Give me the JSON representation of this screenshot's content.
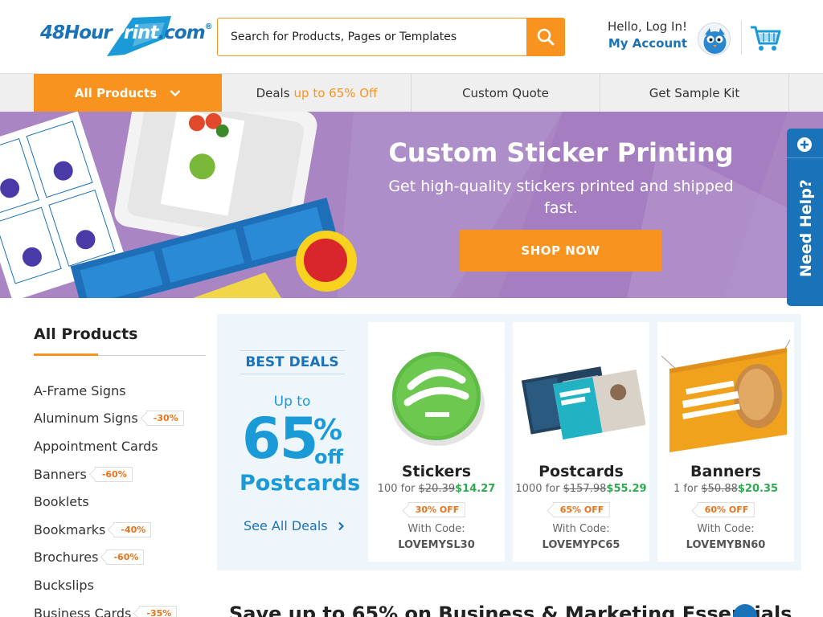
{
  "header": {
    "logo_text": "48HourPrint.com",
    "search_placeholder": "Search for Products, Pages or Templates",
    "greeting": "Hello, Log In!",
    "account_label": "My Account"
  },
  "nav": {
    "all_products": "All Products",
    "deals_label": "Deals",
    "deals_highlight": "up to 65% Off",
    "custom_quote": "Custom Quote",
    "sample_kit": "Get Sample Kit"
  },
  "hero": {
    "title": "Custom Sticker Printing",
    "subtitle": "Get high-quality stickers printed and shipped fast.",
    "button": "SHOP NOW",
    "background": "#a985c4"
  },
  "help_tab": {
    "label": "Need Help?"
  },
  "sidebar": {
    "title": "All Products",
    "items": [
      {
        "label": "A-Frame Signs",
        "badge": ""
      },
      {
        "label": "Aluminum Signs",
        "badge": "-30%"
      },
      {
        "label": "Appointment Cards",
        "badge": ""
      },
      {
        "label": "Banners",
        "badge": "-60%"
      },
      {
        "label": "Booklets",
        "badge": ""
      },
      {
        "label": "Bookmarks",
        "badge": "-40%"
      },
      {
        "label": "Brochures",
        "badge": "-60%"
      },
      {
        "label": "Buckslips",
        "badge": ""
      },
      {
        "label": "Business Cards",
        "badge": "-35%"
      }
    ]
  },
  "best_deals": {
    "title": "BEST DEALS",
    "up_to": "Up to",
    "percent": "65",
    "percent_sign": "%",
    "off": "off",
    "product": "Postcards",
    "see_all": "See All Deals"
  },
  "deal_cards": [
    {
      "name": "Stickers",
      "qty": "100 for",
      "old_price": "$20.39",
      "new_price": "$14.27",
      "badge": "30% OFF",
      "code_label": "With Code:",
      "code": "LOVEMYSL30",
      "image_icon": "sticker-image"
    },
    {
      "name": "Postcards",
      "qty": "1000 for",
      "old_price": "$157.98",
      "new_price": "$55.29",
      "badge": "65% OFF",
      "code_label": "With Code:",
      "code": "LOVEMYPC65",
      "image_icon": "postcard-image"
    },
    {
      "name": "Banners",
      "qty": "1 for",
      "old_price": "$50.88",
      "new_price": "$20.35",
      "badge": "60% OFF",
      "code_label": "With Code:",
      "code": "LOVEMYBN60",
      "image_icon": "banner-image"
    }
  ],
  "bottom_heading": "Save up to 65% on Business & Marketing Essentials",
  "colors": {
    "brand_blue": "#1a73b8",
    "accent_orange": "#f7931e",
    "price_green": "#2eaa4f",
    "deals_bg": "#eef6fc"
  }
}
